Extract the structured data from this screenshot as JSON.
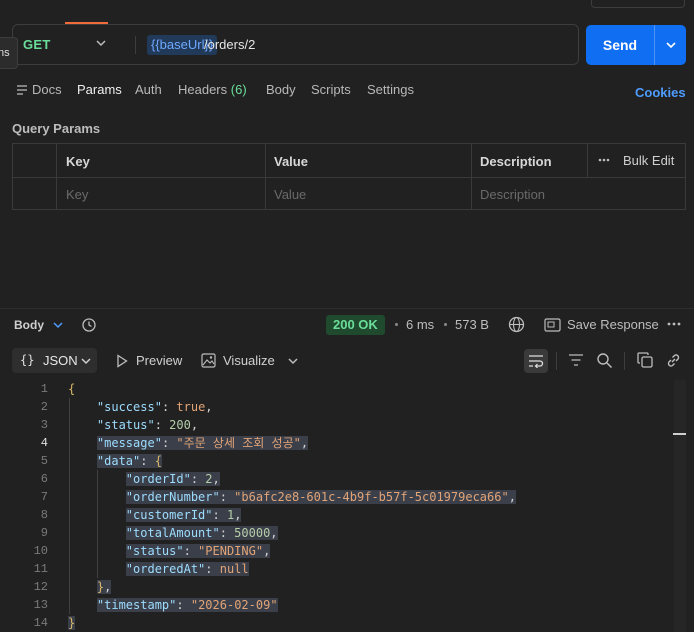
{
  "side_tab": "ns",
  "request": {
    "method": "GET",
    "url_variable": "{{baseUrl}}",
    "url_path": "/orders/2",
    "send_label": "Send"
  },
  "tabs": [
    {
      "label": "Docs"
    },
    {
      "label": "Params"
    },
    {
      "label": "Auth"
    },
    {
      "label": "Headers",
      "count": "(6)"
    },
    {
      "label": "Body"
    },
    {
      "label": "Scripts"
    },
    {
      "label": "Settings"
    }
  ],
  "active_tab": "Params",
  "cookies_label": "Cookies",
  "query_params": {
    "title": "Query Params",
    "headers": [
      "Key",
      "Value",
      "Description"
    ],
    "bulk_edit": "Bulk Edit",
    "placeholders": {
      "key": "Key",
      "value": "Value",
      "description": "Description"
    }
  },
  "response": {
    "body_label": "Body",
    "status": "200 OK",
    "time": "6 ms",
    "size": "573 B",
    "save_label": "Save Response",
    "format": "JSON",
    "preview_label": "Preview",
    "visualize_label": "Visualize"
  },
  "code_lines": [
    "{",
    "    \"success\": true,",
    "    \"status\": 200,",
    "    \"message\": \"주문 상세 조회 성공\",",
    "    \"data\": {",
    "        \"orderId\": 2,",
    "        \"orderNumber\": \"b6afc2e8-601c-4b9f-b57f-5c01979eca66\",",
    "        \"customerId\": 1,",
    "        \"totalAmount\": 50000,",
    "        \"status\": \"PENDING\",",
    "        \"orderedAt\": null",
    "    },",
    "    \"timestamp\": \"2026-02-09\"",
    "}"
  ],
  "active_line": 4,
  "colors": {
    "method_get": "#6bdd9a",
    "send": "#0f6ef2",
    "accent_tab": "#f26b3a",
    "cookies": "#4e9cff",
    "status_ok": "#6bdd9a"
  }
}
